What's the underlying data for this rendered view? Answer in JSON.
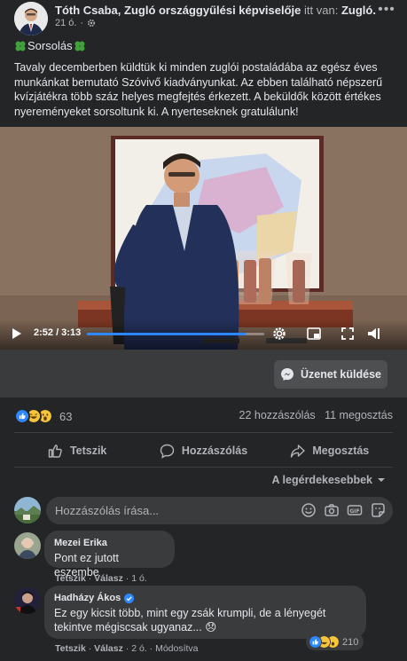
{
  "post": {
    "author": "Tóth Csaba, Zugló országgyűlési képviselője",
    "location_prefix": "itt van:",
    "location": "Zugló",
    "time": "21 ó.",
    "title": "Sorsolás",
    "body": "Tavaly decemberben küldtük ki minden zuglói postaládába az egész éves munkánkat bemutató Szóvivő kiadványunkat. Az ebben található népszerű kvízjátékra több száz helyes megfejtés érkezett. A beküldők között értékes nyereményeket sorsoltunk ki. A nyerteseknek gratulálunk!"
  },
  "video": {
    "time": "2:52 / 3:13",
    "progress": 0.899,
    "message_button": "Üzenet küldése"
  },
  "summary": {
    "reaction_count": "63",
    "comments": "22 hozzászólás",
    "shares": "11 megosztás"
  },
  "actions": {
    "like": "Tetszik",
    "comment": "Hozzászólás",
    "share": "Megosztás"
  },
  "sort_label": "A legérdekesebbek",
  "composer": {
    "placeholder": "Hozzászólás írása..."
  },
  "comments": [
    {
      "name": "Mezei Erika",
      "text": "Pont ez jutott eszembe",
      "like": "Tetszik",
      "reply": "Válasz",
      "time": "1 ó."
    },
    {
      "name": "Hadházy Ákos",
      "text": "Ez egy kicsit több, mint egy zsák krumpli, de a lényegét tekintve mégiscsak ugyanaz... 😞",
      "like": "Tetszik",
      "reply": "Válasz",
      "time": "2 ó.",
      "edited": "Módosítva",
      "reaction_count": "210"
    }
  ],
  "colors": {
    "background": "#242526",
    "accent": "#2d88ff",
    "bubble": "#3a3b3c"
  }
}
